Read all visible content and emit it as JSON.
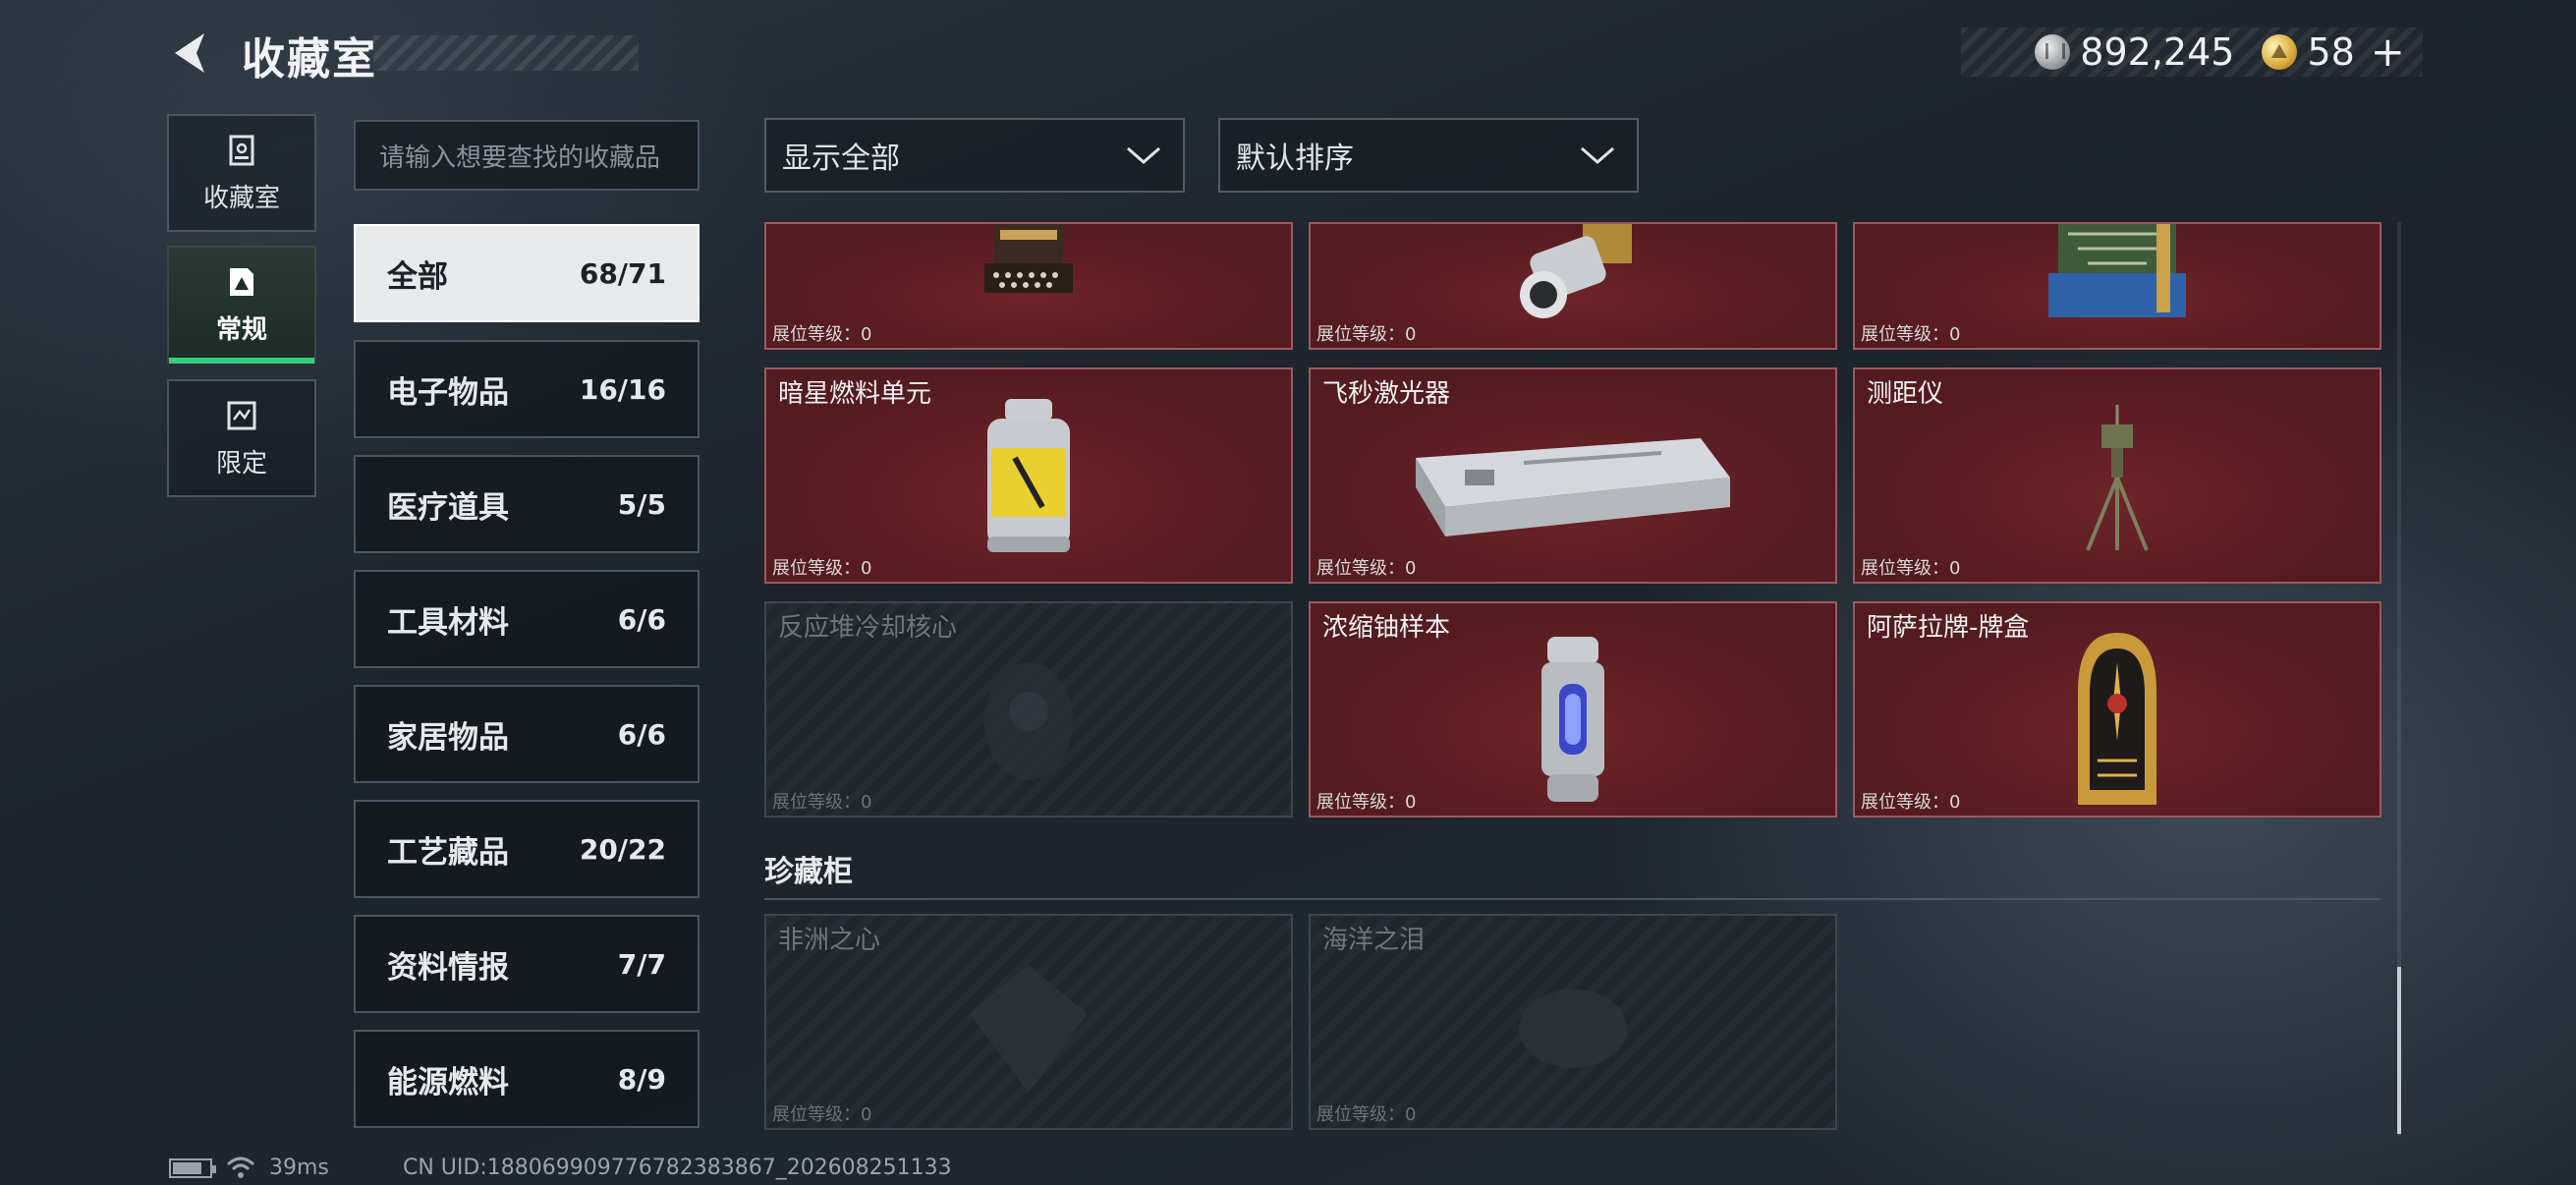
{
  "header": {
    "title": "收藏室",
    "currency_silver": "892,245",
    "currency_gold": "58",
    "plus_label": "+"
  },
  "nav": [
    {
      "label": "收藏室",
      "icon": "collection-room-icon"
    },
    {
      "label": "常规",
      "icon": "regular-icon"
    },
    {
      "label": "限定",
      "icon": "limited-icon"
    }
  ],
  "search": {
    "placeholder": "请输入想要查找的收藏品"
  },
  "categories": [
    {
      "name": "全部",
      "count": "68/71"
    },
    {
      "name": "电子物品",
      "count": "16/16"
    },
    {
      "name": "医疗道具",
      "count": "5/5"
    },
    {
      "name": "工具材料",
      "count": "6/6"
    },
    {
      "name": "家居物品",
      "count": "6/6"
    },
    {
      "name": "工艺藏品",
      "count": "20/22"
    },
    {
      "name": "资料情报",
      "count": "7/7"
    },
    {
      "name": "能源燃料",
      "count": "8/9"
    }
  ],
  "filters": {
    "show": "显示全部",
    "sort": "默认排序"
  },
  "items": [
    {
      "name": "",
      "level": "展位等级：0",
      "icon": "typewriter-icon"
    },
    {
      "name": "",
      "level": "展位等级：0",
      "icon": "lens-device-icon"
    },
    {
      "name": "",
      "level": "展位等级：0",
      "icon": "circuit-machine-icon"
    },
    {
      "name": "暗星燃料单元",
      "level": "展位等级：0",
      "icon": "fuel-canister-icon"
    },
    {
      "name": "飞秒激光器",
      "level": "展位等级：0",
      "icon": "laser-device-icon"
    },
    {
      "name": "测距仪",
      "level": "展位等级：0",
      "icon": "tripod-rangefinder-icon"
    },
    {
      "name": "反应堆冷却核心",
      "level": "展位等级：0",
      "icon": "reactor-core-icon"
    },
    {
      "name": "浓缩铀样本",
      "level": "展位等级：0",
      "icon": "uranium-capsule-icon"
    },
    {
      "name": "阿萨拉牌-牌盒",
      "level": "展位等级：0",
      "icon": "card-box-icon"
    }
  ],
  "treasure": {
    "title": "珍藏柜",
    "items": [
      {
        "name": "非洲之心",
        "level": "展位等级：0",
        "icon": "gem-icon"
      },
      {
        "name": "海洋之泪",
        "level": "展位等级：0",
        "icon": "gem-icon"
      }
    ]
  },
  "footer": {
    "ping": "39ms",
    "uid": "CN UID:1880699097767823838​67_202608251133"
  },
  "colors": {
    "accent_green": "#35d07f",
    "card_red": "#5c1e23",
    "card_border": "#9a5a5e"
  }
}
